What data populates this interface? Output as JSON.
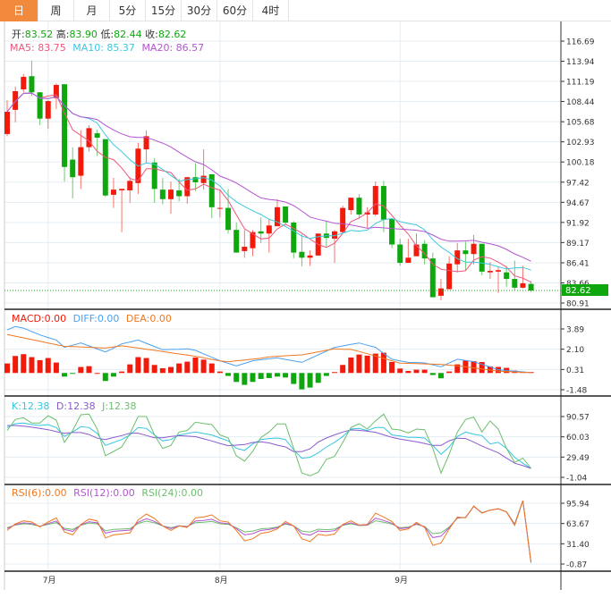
{
  "tabs": [
    {
      "label": "日",
      "active": true
    },
    {
      "label": "周"
    },
    {
      "label": "月"
    },
    {
      "label": "5分"
    },
    {
      "label": "15分"
    },
    {
      "label": "30分"
    },
    {
      "label": "60分"
    },
    {
      "label": "4时"
    }
  ],
  "colors": {
    "up": "#f21a0a",
    "down": "#0ea80e",
    "ma5": "#f0567a",
    "ma10": "#3cc8e0",
    "ma20": "#b455d0",
    "diff": "#4aa0f0",
    "dea": "#f07820",
    "k": "#35c5e0",
    "d": "#8a5ad0",
    "j": "#6cbf6c",
    "rsi6": "#f07820",
    "rsi12": "#b455d0",
    "rsi24": "#6cbf6c",
    "tab_active": "#f28a3e"
  },
  "legend": {
    "ohlc": [
      {
        "label": "开:",
        "value": "83.52"
      },
      {
        "label": "高:",
        "value": "83.90"
      },
      {
        "label": "低:",
        "value": "82.44"
      },
      {
        "label": "收:",
        "value": "82.62"
      }
    ],
    "ma": [
      {
        "label": "MA5: 83.75"
      },
      {
        "label": "MA10: 85.37"
      },
      {
        "label": "MA20: 86.57"
      }
    ],
    "macd": [
      {
        "label": "MACD:0.00"
      },
      {
        "label": "DIFF:0.00"
      },
      {
        "label": "DEA:0.00"
      }
    ],
    "kdj": [
      {
        "label": "K:12.38"
      },
      {
        "label": "D:12.38"
      },
      {
        "label": "J:12.38"
      }
    ],
    "rsi": [
      {
        "label": "RSI(6):0.00"
      },
      {
        "label": "RSI(12):0.00"
      },
      {
        "label": "RSI(24):0.00"
      }
    ]
  },
  "chart_data": [
    {
      "type": "candlestick",
      "yticks": [
        "116.69",
        "113.94",
        "111.19",
        "108.44",
        "105.68",
        "102.93",
        "100.18",
        "97.42",
        "94.67",
        "91.92",
        "89.17",
        "86.41",
        "83.66",
        "80.91"
      ],
      "last_price": "82.62",
      "xticks": [
        {
          "label": "7月",
          "index": 5
        },
        {
          "label": "8月",
          "index": 26
        },
        {
          "label": "9月",
          "index": 48
        }
      ],
      "ohlc": [
        [
          104.0,
          108.6,
          103.7,
          107.04
        ],
        [
          107.3,
          110.5,
          105.6,
          109.85
        ],
        [
          110.1,
          112.2,
          109.7,
          111.8
        ],
        [
          111.9,
          114.0,
          109.2,
          109.7
        ],
        [
          109.7,
          109.7,
          105.2,
          106.1
        ],
        [
          106.1,
          108.6,
          104.7,
          108.5
        ],
        [
          108.9,
          110.9,
          107.4,
          110.7
        ],
        [
          110.8,
          110.8,
          97.5,
          99.5
        ],
        [
          100.5,
          102.2,
          95.2,
          98.1
        ],
        [
          98.3,
          104.5,
          96.5,
          102.2
        ],
        [
          102.2,
          105.2,
          101.6,
          104.8
        ],
        [
          104.1,
          104.6,
          101.0,
          103.5
        ],
        [
          103.3,
          103.3,
          95.4,
          95.6
        ],
        [
          95.7,
          98.0,
          93.9,
          96.4
        ],
        [
          96.3,
          96.5,
          90.6,
          96.5
        ],
        [
          96.3,
          98.1,
          94.6,
          97.6
        ],
        [
          97.3,
          102.8,
          95.8,
          102.0
        ],
        [
          101.9,
          104.5,
          100.1,
          103.7
        ],
        [
          100.1,
          100.7,
          94.6,
          96.5
        ],
        [
          96.4,
          98.0,
          94.4,
          95.1
        ],
        [
          95.1,
          97.5,
          93.1,
          96.4
        ],
        [
          96.3,
          97.9,
          94.8,
          95.5
        ],
        [
          95.5,
          98.1,
          94.5,
          98.1
        ],
        [
          98.1,
          100.0,
          96.2,
          97.4
        ],
        [
          97.3,
          101.9,
          96.4,
          98.3
        ],
        [
          98.5,
          98.5,
          92.5,
          94.0
        ],
        [
          93.8,
          96.4,
          92.6,
          93.9
        ],
        [
          93.9,
          96.5,
          90.4,
          90.9
        ],
        [
          90.9,
          91.9,
          87.8,
          87.8
        ],
        [
          88.0,
          90.9,
          87.1,
          88.6
        ],
        [
          88.4,
          90.9,
          87.3,
          90.6
        ],
        [
          90.7,
          92.6,
          89.1,
          90.4
        ],
        [
          90.4,
          92.4,
          87.8,
          91.5
        ],
        [
          91.4,
          95.1,
          91.4,
          94.0
        ],
        [
          94.1,
          94.1,
          91.7,
          91.9
        ],
        [
          91.9,
          92.1,
          87.0,
          87.8
        ],
        [
          87.9,
          90.3,
          85.9,
          87.1
        ],
        [
          87.1,
          88.1,
          86.0,
          87.4
        ],
        [
          87.4,
          90.4,
          87.4,
          90.4
        ],
        [
          90.4,
          92.1,
          88.5,
          89.8
        ],
        [
          89.7,
          90.9,
          86.4,
          90.7
        ],
        [
          90.6,
          94.2,
          90.4,
          93.9
        ],
        [
          93.6,
          95.3,
          93.0,
          95.3
        ],
        [
          95.3,
          95.8,
          92.4,
          93.0
        ],
        [
          93.0,
          94.0,
          91.2,
          93.3
        ],
        [
          93.0,
          97.5,
          92.8,
          96.9
        ],
        [
          96.9,
          97.6,
          90.6,
          92.3
        ],
        [
          92.4,
          92.4,
          88.4,
          88.9
        ],
        [
          88.9,
          89.7,
          86.0,
          86.4
        ],
        [
          86.4,
          89.7,
          86.4,
          87.1
        ],
        [
          87.3,
          90.4,
          87.3,
          88.9
        ],
        [
          89.0,
          89.5,
          86.2,
          87.0
        ],
        [
          87.0,
          87.8,
          81.7,
          81.7
        ],
        [
          81.9,
          84.2,
          81.3,
          82.9
        ],
        [
          82.8,
          87.3,
          82.8,
          86.3
        ],
        [
          86.2,
          89.1,
          85.1,
          88.1
        ],
        [
          88.1,
          89.3,
          85.3,
          87.6
        ],
        [
          87.6,
          90.2,
          86.2,
          89.0
        ],
        [
          89.0,
          89.0,
          84.7,
          85.2
        ],
        [
          85.1,
          86.5,
          84.2,
          85.3
        ],
        [
          85.2,
          85.9,
          82.3,
          85.4
        ],
        [
          85.1,
          86.0,
          83.1,
          84.2
        ],
        [
          84.2,
          86.7,
          82.6,
          83.0
        ],
        [
          83.0,
          86.0,
          82.9,
          83.6
        ],
        [
          83.52,
          83.9,
          82.44,
          82.62
        ]
      ],
      "ma_periods": [
        5,
        10,
        20
      ]
    },
    {
      "type": "macd",
      "yticks": [
        "3.89",
        "2.10",
        "0.31",
        "-1.48"
      ],
      "macd": [
        0.84,
        1.5,
        1.66,
        1.4,
        1.13,
        1.32,
        0.92,
        -0.32,
        -0.05,
        0.53,
        0.6,
        0.0,
        -0.71,
        -0.32,
        0.13,
        0.76,
        1.4,
        1.32,
        0.71,
        0.42,
        0.53,
        0.84,
        1.0,
        1.37,
        1.18,
        0.84,
        0.13,
        -0.26,
        -0.79,
        -1.05,
        -0.79,
        -0.53,
        -0.45,
        -0.32,
        -0.4,
        -0.97,
        -1.45,
        -1.29,
        -0.87,
        -0.26,
        0.08,
        0.71,
        1.37,
        1.63,
        1.53,
        1.71,
        1.79,
        0.97,
        0.39,
        0.18,
        0.29,
        0.29,
        -0.18,
        -0.47,
        0.13,
        0.76,
        1.1,
        1.05,
        0.97,
        0.58,
        0.53,
        0.45,
        0.21,
        0.1,
        0.08
      ],
      "diff": [
        3.8,
        4.1,
        3.96,
        3.66,
        3.36,
        3.13,
        2.91,
        2.26,
        2.45,
        2.65,
        2.39,
        2.12,
        1.86,
        2.2,
        2.57,
        2.74,
        2.91,
        2.62,
        2.34,
        2.05,
        2.08,
        2.1,
        2.13,
        2.0,
        1.69,
        1.39,
        1.08,
        0.85,
        0.63,
        0.85,
        1.08,
        1.17,
        1.25,
        1.34,
        1.2,
        1.07,
        0.94,
        1.27,
        1.6,
        1.93,
        2.26,
        2.39,
        2.52,
        2.65,
        2.45,
        2.26,
        1.73,
        1.21,
        1.07,
        0.94,
        0.92,
        0.89,
        0.72,
        0.55,
        0.88,
        1.21,
        1.1,
        1.0,
        0.76,
        0.53,
        0.29,
        0.22,
        0.16,
        0.1,
        0.03
      ],
      "dea": [
        3.4,
        3.25,
        3.1,
        2.95,
        2.8,
        2.65,
        2.5,
        2.35,
        2.33,
        2.3,
        2.27,
        2.23,
        2.2,
        2.3,
        2.4,
        2.3,
        2.2,
        2.1,
        2.0,
        1.9,
        1.79,
        1.68,
        1.58,
        1.47,
        1.34,
        1.2,
        1.07,
        1.0,
        1.08,
        1.15,
        1.23,
        1.3,
        1.42,
        1.47,
        1.52,
        1.56,
        1.6,
        1.73,
        1.87,
        2.0,
        2.13,
        2.1,
        2.08,
        1.9,
        1.7,
        1.5,
        1.29,
        1.08,
        0.87,
        0.85,
        0.83,
        0.8,
        0.78,
        0.76,
        0.69,
        0.62,
        0.55,
        0.45,
        0.35,
        0.26,
        0.16,
        0.13,
        0.09,
        0.06,
        0.03
      ]
    },
    {
      "type": "kdj",
      "yticks": [
        "90.57",
        "60.03",
        "29.49",
        "-1.04"
      ],
      "k": [
        74,
        79.8,
        80.7,
        78.5,
        77.1,
        78.5,
        74,
        60.5,
        67.3,
        75.3,
        74,
        65,
        47.1,
        51.5,
        56,
        62.8,
        74,
        72.6,
        62.8,
        53.8,
        56,
        62.8,
        65,
        67.3,
        65,
        62.8,
        58.3,
        53.8,
        42.6,
        39.5,
        49.3,
        56,
        57.4,
        58.3,
        56,
        40.4,
        27.8,
        29.2,
        35.9,
        44.8,
        51.6,
        60.5,
        71.7,
        72.6,
        69.5,
        74,
        74,
        62.8,
        61.4,
        59.2,
        59.2,
        58.3,
        47.1,
        33.6,
        44.8,
        60.5,
        67.3,
        63.7,
        61.9,
        49.3,
        51.6,
        42.6,
        29.2,
        20.2,
        12.38
      ],
      "d": [
        77.1,
        77.1,
        76,
        74.5,
        72.8,
        70.8,
        67.8,
        65.3,
        66.5,
        66.5,
        63.5,
        58,
        56,
        59,
        61.9,
        65.5,
        65.5,
        62,
        58.7,
        58.5,
        60.5,
        61.7,
        61,
        60.2,
        57,
        53.8,
        50,
        46.6,
        47.5,
        48.4,
        51.5,
        52.5,
        50.8,
        47.5,
        44.8,
        37.7,
        37.7,
        42,
        52,
        58.3,
        63,
        67.3,
        70.4,
        69.8,
        68.5,
        66.8,
        63,
        59.2,
        56.5,
        54.5,
        52.5,
        50,
        47.1,
        47.1,
        54,
        58,
        57.4,
        52,
        46,
        41,
        35.9,
        28,
        20.2,
        16.6,
        12.38
      ],
      "j": [
        69.5,
        86.1,
        88.8,
        80.7,
        80.7,
        91.9,
        85.2,
        51.6,
        69.5,
        93.3,
        94.2,
        71.7,
        31.4,
        38,
        44.8,
        65,
        90.6,
        90.6,
        62.8,
        42.6,
        47.1,
        67.3,
        69.5,
        82.1,
        80,
        78.5,
        62.8,
        58.3,
        31.4,
        23.3,
        38.1,
        59.2,
        67.3,
        79.4,
        79.4,
        42.6,
        5.4,
        1.4,
        6.7,
        26,
        30.5,
        51.6,
        74,
        79.8,
        71.7,
        84.3,
        94.2,
        71.7,
        70.4,
        65.9,
        71.7,
        70.8,
        42.6,
        5.4,
        33.6,
        67.3,
        86.1,
        89.7,
        67.3,
        83.8,
        71.7,
        42.6,
        21.5,
        27.8,
        12.38
      ]
    },
    {
      "type": "rsi",
      "yticks": [
        "95.94",
        "63.67",
        "31.40",
        "-0.87"
      ],
      "rsi6": [
        52.6,
        63.1,
        67.9,
        66,
        58.3,
        66,
        72.6,
        50.2,
        45.5,
        62.2,
        70.7,
        67.9,
        40.7,
        45.5,
        47,
        48.8,
        69.3,
        78.8,
        71.7,
        59.8,
        52.6,
        59.8,
        57.4,
        72.6,
        74,
        77.4,
        67.9,
        66,
        52.6,
        36,
        39.3,
        47.9,
        50.2,
        55,
        66.9,
        59.8,
        39.3,
        35,
        46.4,
        44.5,
        47,
        62.2,
        67.9,
        61.2,
        62.2,
        80.2,
        74,
        66.9,
        52.6,
        55,
        65.5,
        57.4,
        28.8,
        32.6,
        55,
        74,
        72.6,
        91.6,
        80.2,
        85,
        87.4,
        82.1,
        60.7,
        100,
        1.2
      ],
      "rsi12": [
        55.6,
        61.9,
        64.7,
        63.6,
        59.0,
        63.6,
        67.6,
        54.1,
        51.3,
        61.3,
        66.4,
        64.7,
        48.4,
        51.3,
        52.2,
        53.3,
        65.6,
        71.3,
        67.0,
        59.9,
        55.6,
        59.9,
        58.4,
        67.6,
        68.4,
        70.4,
        64.7,
        63.6,
        55.6,
        45.6,
        47.6,
        52.7,
        54.1,
        57.0,
        64.1,
        59.9,
        47.6,
        45.0,
        51.8,
        50.7,
        52.2,
        61.3,
        64.7,
        60.7,
        61.3,
        72.1,
        68.4,
        64.1,
        55.6,
        57.0,
        63.3,
        58.4,
        41.3,
        43.6,
        57.0,
        73,
        73,
        91,
        80.5,
        85,
        87,
        82,
        62,
        100,
        1.2
      ],
      "rsi24": [
        57.0,
        61.2,
        63.2,
        62.4,
        59.3,
        62.4,
        65.0,
        56.1,
        54.2,
        60.9,
        64.3,
        63.2,
        52.3,
        54.2,
        54.8,
        55.5,
        63.7,
        67.5,
        64.7,
        59.9,
        57.0,
        59.9,
        59.0,
        65.0,
        65.6,
        67.0,
        63.2,
        62.4,
        57.0,
        50.4,
        51.7,
        55.2,
        56.1,
        58.0,
        62.8,
        59.9,
        51.7,
        50.0,
        54.6,
        53.8,
        54.8,
        60.9,
        63.2,
        60.5,
        60.9,
        68.1,
        65.6,
        62.8,
        57.0,
        58.0,
        62.2,
        59.0,
        47.5,
        49.0,
        58.0,
        72,
        73.5,
        91,
        81,
        85,
        87,
        82.5,
        63,
        100,
        1.2
      ]
    }
  ]
}
